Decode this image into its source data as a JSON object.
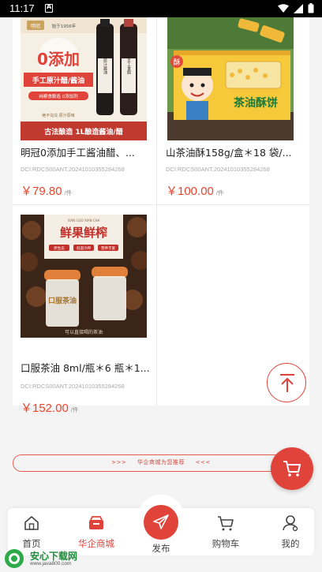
{
  "status_bar": {
    "time": "11:17"
  },
  "products": [
    {
      "name": "明冠0添加手工酱油醋、...",
      "code": "DCI:RDCS00ANT.20241010355284268",
      "price": "￥79.80",
      "unit": "/件",
      "image": {
        "brand": "明冠",
        "since": "始于1956年",
        "headline": "0添加",
        "subtitle": "手工原汁醋/酱油",
        "badge": "纯粮食酿造 0添加剂",
        "note": "绝不勾兑 原汁原味",
        "banner": "古法酿造 1L酿造酱油/醋",
        "label_a": "原汁酱油",
        "label_b": "手工食醋"
      }
    },
    {
      "name": "山茶油酥158g/盒＊18 袋/...",
      "code": "DCI:RDCS00ANT.20241010355284268",
      "price": "￥100.00",
      "unit": "/件",
      "image": {
        "box_text": "茶油酥饼",
        "tag": "酥"
      }
    },
    {
      "name": "口服茶油 8ml/瓶＊6 瓶＊1...",
      "code": "DCI:RDCS00ANT.20241010355284268",
      "price": "￥152.00",
      "unit": "/件",
      "image": {
        "top_small": "XIAN GUO XIAN CHA",
        "headline": "鲜果鲜榨",
        "chips": [
          "原生态",
          "低温冷榨",
          "营养丰富"
        ],
        "bottle_text": "口服茶油",
        "bottom": "可以直接喝的茶油"
      }
    }
  ],
  "slogan": {
    "arrows_left": ">>>",
    "text": "华企商城为您推荐",
    "arrows_right": "<<<"
  },
  "tabbar": {
    "home": "首页",
    "shop": "华企商城",
    "publish": "发布",
    "cart": "购物车",
    "mine": "我的"
  },
  "watermark": {
    "title": "安心下载网",
    "url": "www.java800.com"
  },
  "colors": {
    "accent": "#e0433a",
    "price": "#e8452c"
  }
}
